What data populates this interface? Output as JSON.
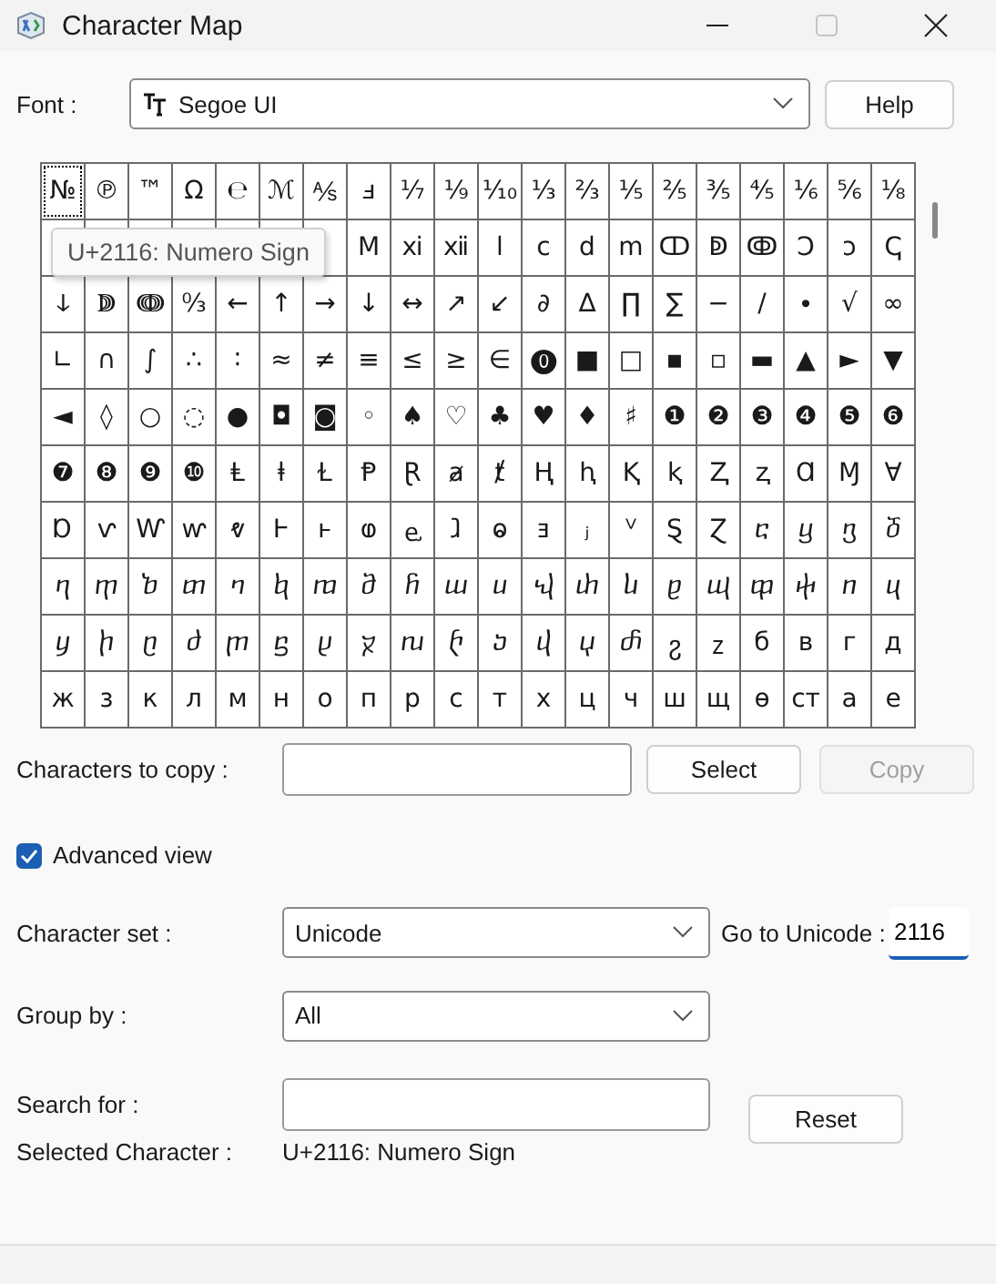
{
  "window": {
    "title": "Character Map"
  },
  "font": {
    "label": "Font :",
    "value": "Segoe UI"
  },
  "help_button": "Help",
  "grid": {
    "rows": [
      [
        {
          "c": "№",
          "selected": true
        },
        {
          "c": "℗",
          "selected": false
        },
        {
          "c": "™",
          "selected": false
        },
        {
          "c": "Ω",
          "selected": false
        },
        {
          "c": "℮",
          "selected": false
        },
        {
          "c": "ℳ",
          "selected": false
        },
        {
          "c": "⅍",
          "selected": false
        },
        {
          "c": "ⅎ",
          "selected": false
        },
        {
          "c": "⅐",
          "selected": false
        },
        {
          "c": "⅑",
          "selected": false
        },
        {
          "c": "⅒",
          "selected": false
        },
        {
          "c": "⅓",
          "selected": false
        },
        {
          "c": "⅔",
          "selected": false
        },
        {
          "c": "⅕",
          "selected": false
        },
        {
          "c": "⅖",
          "selected": false
        },
        {
          "c": "⅗",
          "selected": false
        },
        {
          "c": "⅘",
          "selected": false
        },
        {
          "c": "⅙",
          "selected": false
        },
        {
          "c": "⅚",
          "selected": false
        },
        {
          "c": "⅛",
          "selected": false
        }
      ],
      [
        {
          "selected": false
        },
        {
          "selected": false
        },
        {
          "selected": false
        },
        {
          "selected": false
        },
        {
          "selected": false
        },
        {
          "selected": false
        },
        {
          "selected": false
        },
        {
          "c": "Ⅿ",
          "selected": false
        },
        {
          "c": "ⅺ",
          "selected": false
        },
        {
          "c": "ⅻ",
          "selected": false
        },
        {
          "c": "ⅼ",
          "selected": false
        },
        {
          "c": "ⅽ",
          "selected": false
        },
        {
          "c": "ⅾ",
          "selected": false
        },
        {
          "c": "ⅿ",
          "selected": false
        },
        {
          "c": "ↀ",
          "selected": false
        },
        {
          "c": "ↁ",
          "selected": false
        },
        {
          "c": "ↂ",
          "selected": false
        },
        {
          "c": "Ↄ",
          "selected": false
        },
        {
          "c": "ↄ",
          "selected": false
        },
        {
          "c": "ↅ",
          "selected": false
        }
      ],
      [
        {
          "c": "ↆ",
          "selected": false
        },
        {
          "c": "ↇ",
          "selected": false
        },
        {
          "c": "ↈ",
          "selected": false
        },
        {
          "c": "↉",
          "selected": false
        },
        {
          "c": "←",
          "selected": false
        },
        {
          "c": "↑",
          "selected": false
        },
        {
          "c": "→",
          "selected": false
        },
        {
          "c": "↓",
          "selected": false
        },
        {
          "c": "↔",
          "selected": false
        },
        {
          "c": "↗",
          "selected": false
        },
        {
          "c": "↙",
          "selected": false
        },
        {
          "c": "∂",
          "selected": false
        },
        {
          "c": "∆",
          "selected": false
        },
        {
          "c": "∏",
          "selected": false
        },
        {
          "c": "∑",
          "selected": false
        },
        {
          "c": "−",
          "selected": false
        },
        {
          "c": "∕",
          "selected": false
        },
        {
          "c": "∙",
          "selected": false
        },
        {
          "c": "√",
          "selected": false
        },
        {
          "c": "∞",
          "selected": false
        }
      ],
      [
        {
          "c": "∟",
          "selected": false
        },
        {
          "c": "∩",
          "selected": false
        },
        {
          "c": "∫",
          "selected": false
        },
        {
          "c": "∴",
          "selected": false
        },
        {
          "c": "∶",
          "selected": false
        },
        {
          "c": "≈",
          "selected": false
        },
        {
          "c": "≠",
          "selected": false
        },
        {
          "c": "≡",
          "selected": false
        },
        {
          "c": "≤",
          "selected": false
        },
        {
          "c": "≥",
          "selected": false
        },
        {
          "c": "∈",
          "selected": false
        },
        {
          "c": "⓿",
          "selected": false
        },
        {
          "c": "■",
          "selected": false
        },
        {
          "c": "□",
          "selected": false
        },
        {
          "c": "▪",
          "selected": false
        },
        {
          "c": "▫",
          "selected": false
        },
        {
          "c": "▬",
          "selected": false
        },
        {
          "c": "▲",
          "selected": false
        },
        {
          "c": "►",
          "selected": false
        },
        {
          "c": "▼",
          "selected": false
        }
      ],
      [
        {
          "c": "◄",
          "selected": false
        },
        {
          "c": "◊",
          "selected": false
        },
        {
          "c": "○",
          "selected": false
        },
        {
          "c": "◌",
          "selected": false
        },
        {
          "c": "●",
          "selected": false
        },
        {
          "c": "◘",
          "selected": false
        },
        {
          "c": "◙",
          "selected": false
        },
        {
          "c": "◦",
          "selected": false
        },
        {
          "c": "♠",
          "selected": false
        },
        {
          "c": "♡",
          "selected": false
        },
        {
          "c": "♣",
          "selected": false
        },
        {
          "c": "♥",
          "selected": false
        },
        {
          "c": "♦",
          "selected": false
        },
        {
          "c": "♯",
          "selected": false
        },
        {
          "c": "❶",
          "selected": false
        },
        {
          "c": "❷",
          "selected": false
        },
        {
          "c": "❸",
          "selected": false
        },
        {
          "c": "❹",
          "selected": false
        },
        {
          "c": "❺",
          "selected": false
        },
        {
          "c": "❻",
          "selected": false
        }
      ],
      [
        {
          "c": "❼",
          "selected": false
        },
        {
          "c": "❽",
          "selected": false
        },
        {
          "c": "❾",
          "selected": false
        },
        {
          "c": "❿",
          "selected": false
        },
        {
          "c": "Ⱡ",
          "selected": false
        },
        {
          "c": "ⱡ",
          "selected": false
        },
        {
          "c": "Ɫ",
          "selected": false
        },
        {
          "c": "Ᵽ",
          "selected": false
        },
        {
          "c": "Ɽ",
          "selected": false
        },
        {
          "c": "ⱥ",
          "selected": false
        },
        {
          "c": "ⱦ",
          "selected": false
        },
        {
          "c": "Ⱨ",
          "selected": false
        },
        {
          "c": "ⱨ",
          "selected": false
        },
        {
          "c": "Ⱪ",
          "selected": false
        },
        {
          "c": "ⱪ",
          "selected": false
        },
        {
          "c": "Ⱬ",
          "selected": false
        },
        {
          "c": "ⱬ",
          "selected": false
        },
        {
          "c": "Ɑ",
          "selected": false
        },
        {
          "c": "Ɱ",
          "selected": false
        },
        {
          "c": "Ɐ",
          "selected": false
        }
      ],
      [
        {
          "c": "Ɒ",
          "selected": false
        },
        {
          "c": "ⱱ",
          "selected": false
        },
        {
          "c": "Ⱳ",
          "selected": false
        },
        {
          "c": "ⱳ",
          "selected": false
        },
        {
          "c": "ⱴ",
          "selected": false
        },
        {
          "c": "Ⱶ",
          "selected": false
        },
        {
          "c": "ⱶ",
          "selected": false
        },
        {
          "c": "ⱷ",
          "selected": false
        },
        {
          "c": "ⱸ",
          "selected": false
        },
        {
          "c": "ⱹ",
          "selected": false
        },
        {
          "c": "ⱺ",
          "selected": false
        },
        {
          "c": "ⱻ",
          "selected": false
        },
        {
          "c": "ⱼ",
          "selected": false
        },
        {
          "c": "ⱽ",
          "selected": false
        },
        {
          "c": "Ȿ",
          "selected": false
        },
        {
          "c": "Ɀ",
          "selected": false
        },
        {
          "c": "ⴀ",
          "selected": false
        },
        {
          "c": "ⴁ",
          "selected": false
        },
        {
          "c": "ⴂ",
          "selected": false
        },
        {
          "c": "ⴃ",
          "selected": false
        }
      ],
      [
        {
          "c": "ⴄ",
          "selected": false
        },
        {
          "c": "ⴅ",
          "selected": false
        },
        {
          "c": "ⴆ",
          "selected": false
        },
        {
          "c": "ⴇ",
          "selected": false
        },
        {
          "c": "ⴈ",
          "selected": false
        },
        {
          "c": "ⴉ",
          "selected": false
        },
        {
          "c": "ⴊ",
          "selected": false
        },
        {
          "c": "ⴋ",
          "selected": false
        },
        {
          "c": "ⴌ",
          "selected": false
        },
        {
          "c": "ⴍ",
          "selected": false
        },
        {
          "c": "ⴎ",
          "selected": false
        },
        {
          "c": "ⴏ",
          "selected": false
        },
        {
          "c": "ⴐ",
          "selected": false
        },
        {
          "c": "ⴑ",
          "selected": false
        },
        {
          "c": "ⴒ",
          "selected": false
        },
        {
          "c": "ⴓ",
          "selected": false
        },
        {
          "c": "ⴔ",
          "selected": false
        },
        {
          "c": "ⴕ",
          "selected": false
        },
        {
          "c": "ⴖ",
          "selected": false
        },
        {
          "c": "ⴗ",
          "selected": false
        }
      ],
      [
        {
          "c": "ⴘ",
          "selected": false
        },
        {
          "c": "ⴙ",
          "selected": false
        },
        {
          "c": "ⴚ",
          "selected": false
        },
        {
          "c": "ⴛ",
          "selected": false
        },
        {
          "c": "ⴜ",
          "selected": false
        },
        {
          "c": "ⴝ",
          "selected": false
        },
        {
          "c": "ⴞ",
          "selected": false
        },
        {
          "c": "ⴟ",
          "selected": false
        },
        {
          "c": "ⴠ",
          "selected": false
        },
        {
          "c": "ⴡ",
          "selected": false
        },
        {
          "c": "ⴢ",
          "selected": false
        },
        {
          "c": "ⴣ",
          "selected": false
        },
        {
          "c": "ⴤ",
          "selected": false
        },
        {
          "c": "ⴥ",
          "selected": false
        },
        {
          "c": "ⴧ",
          "selected": false
        },
        {
          "c": "ⴭ",
          "selected": false
        },
        {
          "c": "б",
          "selected": false
        },
        {
          "c": "в",
          "selected": false
        },
        {
          "c": "г",
          "selected": false
        },
        {
          "c": "д",
          "selected": false
        }
      ],
      [
        {
          "c": "ж",
          "selected": false
        },
        {
          "c": "з",
          "selected": false
        },
        {
          "c": "к",
          "selected": false
        },
        {
          "c": "л",
          "selected": false
        },
        {
          "c": "м",
          "selected": false
        },
        {
          "c": "н",
          "selected": false
        },
        {
          "c": "о",
          "selected": false
        },
        {
          "c": "п",
          "selected": false
        },
        {
          "c": "р",
          "selected": false
        },
        {
          "c": "с",
          "selected": false
        },
        {
          "c": "т",
          "selected": false
        },
        {
          "c": "х",
          "selected": false
        },
        {
          "c": "ц",
          "selected": false
        },
        {
          "c": "ч",
          "selected": false
        },
        {
          "c": "ш",
          "selected": false
        },
        {
          "c": "щ",
          "selected": false
        },
        {
          "c": "ѳ",
          "selected": false
        },
        {
          "c": "ст",
          "selected": false
        },
        {
          "c": "а",
          "selected": false
        },
        {
          "c": "е",
          "selected": false
        }
      ]
    ]
  },
  "tooltip": "U+2116: Numero Sign",
  "copy_field": {
    "label": "Characters to copy :"
  },
  "select_button": "Select",
  "copy_button": {
    "label": "Copy",
    "disabled": true
  },
  "advanced_view": {
    "label": "Advanced view",
    "checked": true
  },
  "character_set": {
    "label": "Character set :",
    "value": "Unicode"
  },
  "goto_unicode": {
    "label": "Go to Unicode :",
    "value": "2116"
  },
  "group_by": {
    "label": "Group by :",
    "value": "All"
  },
  "search": {
    "label": "Search for :"
  },
  "reset_button": "Reset",
  "selected_character": {
    "label": "Selected Character :",
    "value": "U+2116: Numero Sign"
  }
}
